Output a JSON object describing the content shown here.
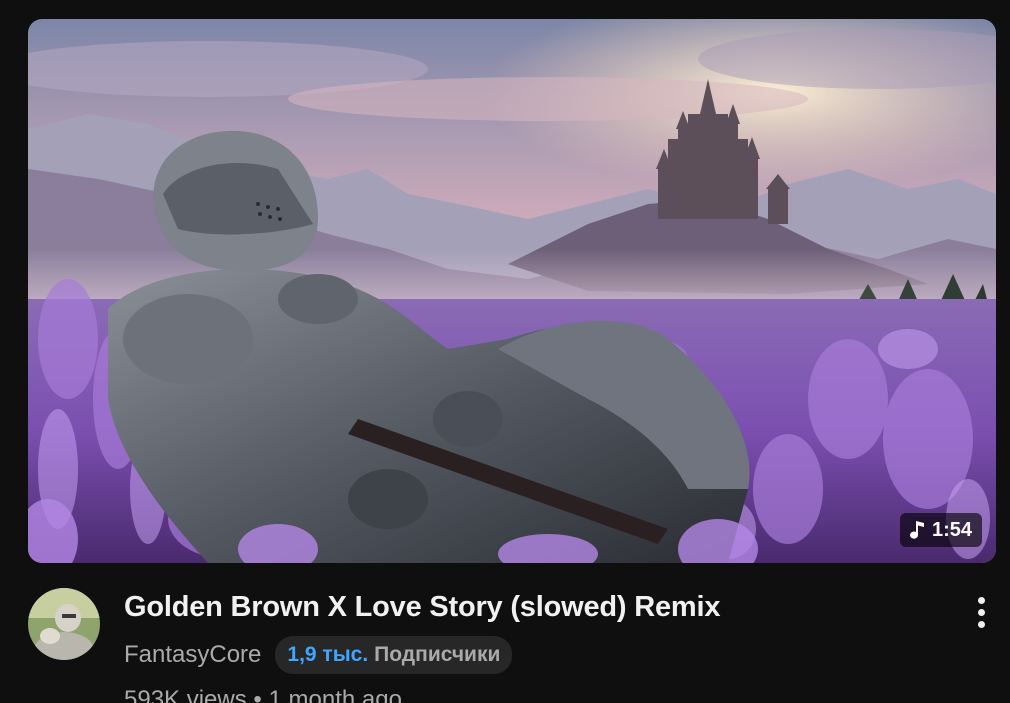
{
  "video": {
    "title": "Golden Brown X Love Story (slowed) Remix",
    "duration": "1:54",
    "views": "593K views",
    "separator": "•",
    "age": "1 month ago"
  },
  "channel": {
    "name": "FantasyCore",
    "subscriber_count": "1,9 тыс.",
    "subscriber_label": "Подписчики"
  },
  "icons": {
    "duration_badge": "music-note-icon",
    "menu": "more-vert-icon"
  },
  "colors": {
    "background": "#0f0f0f",
    "title": "#f1f1f1",
    "secondary_text": "#aaaaaa",
    "subscriber_accent": "#3ea6ff",
    "badge_background": "#272727"
  }
}
